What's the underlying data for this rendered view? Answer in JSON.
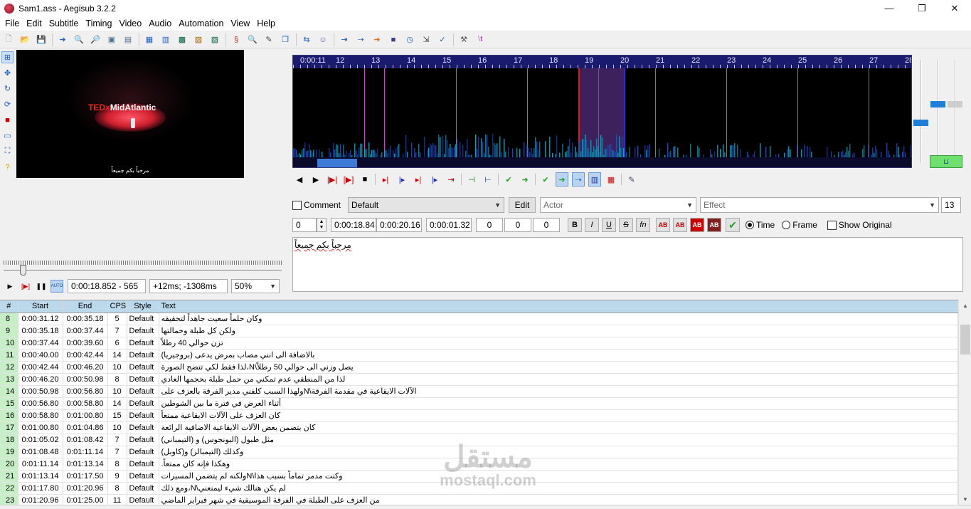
{
  "window": {
    "title": "Sam1.ass - Aegisub 3.2.2",
    "minimize_glyph": "—",
    "maximize_glyph": "❐",
    "close_glyph": "✕"
  },
  "menu": [
    "File",
    "Edit",
    "Subtitle",
    "Timing",
    "Video",
    "Audio",
    "Automation",
    "View",
    "Help"
  ],
  "video": {
    "logo_ted": "TEDx",
    "logo_name": "MidAtlantic",
    "subtitle": "مرحباً بكم جميعاً"
  },
  "video_controls": {
    "time_frame": "0:00:18.852 - 565",
    "offset": "+12ms; -1308ms",
    "zoom": "50%"
  },
  "audio": {
    "ruler_labels": [
      "0:00:11",
      "12",
      "13",
      "14",
      "15",
      "16",
      "17",
      "18",
      "19",
      "20",
      "21",
      "22",
      "23",
      "24",
      "25",
      "26",
      "27",
      "28"
    ]
  },
  "editor": {
    "comment_label": "Comment",
    "style": "Default",
    "edit_button": "Edit",
    "actor_placeholder": "Actor",
    "effect_placeholder": "Effect",
    "line_number": "13",
    "layer": "0",
    "start_time": "0:00:18.84",
    "end_time": "0:00:20.16",
    "duration": "0:00:01.32",
    "margin_left": "0",
    "margin_right": "0",
    "margin_vert": "0",
    "bold": "B",
    "italic": "I",
    "underline": "U",
    "strike": "S",
    "fn": "fn",
    "color_labels": [
      "AB",
      "AB",
      "AB",
      "AB"
    ],
    "time_radio": "Time",
    "frame_radio": "Frame",
    "show_original": "Show Original",
    "text": "مرحباً بكم جميعاً"
  },
  "grid": {
    "headers": [
      "#",
      "Start",
      "End",
      "CPS",
      "Style",
      "Text"
    ],
    "rows": [
      {
        "n": "8",
        "start": "0:00:31.12",
        "end": "0:00:35.18",
        "cps": "5",
        "style": "Default",
        "text": "وكان حلماً سعيت جاهداً لتحقيقه"
      },
      {
        "n": "9",
        "start": "0:00:35.18",
        "end": "0:00:37.44",
        "cps": "7",
        "style": "Default",
        "text": "ولكن كل طبلة وحمالتها"
      },
      {
        "n": "10",
        "start": "0:00:37.44",
        "end": "0:00:39.60",
        "cps": "6",
        "style": "Default",
        "text": "تزن حوالي 40 رطلاً"
      },
      {
        "n": "11",
        "start": "0:00:40.00",
        "end": "0:00:42.44",
        "cps": "14",
        "style": "Default",
        "text": "بالاضافة الى انني مصاب بمرض يدعى (بروجيريا)"
      },
      {
        "n": "12",
        "start": "0:00:42.44",
        "end": "0:00:46.20",
        "cps": "10",
        "style": "Default",
        "text": "يصل وزني الى حوالي 50 رطلاً\\N،لذا فقط لكي تتضح الصورة"
      },
      {
        "n": "13",
        "start": "0:00:46.20",
        "end": "0:00:50.98",
        "cps": "8",
        "style": "Default",
        "text": "لذا من المنطقي عدم تمكني من حمل طبلة بحجمها العادي"
      },
      {
        "n": "14",
        "start": "0:00:50.98",
        "end": "0:00:56.80",
        "cps": "10",
        "style": "Default",
        "text": "الآلات الايقاعية في مقدمة الفرقة\\Nولهذا السبب كلفني مدير الفرقة بالعزف على"
      },
      {
        "n": "15",
        "start": "0:00:56.80",
        "end": "0:00:58.80",
        "cps": "14",
        "style": "Default",
        "text": "أثناء العرض في فترة ما بين الشوطين"
      },
      {
        "n": "16",
        "start": "0:00:58.80",
        "end": "0:01:00.80",
        "cps": "15",
        "style": "Default",
        "text": "كان العزف على الآلات الايقاعية ممتعاً"
      },
      {
        "n": "17",
        "start": "0:01:00.80",
        "end": "0:01:04.86",
        "cps": "10",
        "style": "Default",
        "text": "كان يتضمن بعض الآلات الايقاعية الاضافية الرائعة"
      },
      {
        "n": "18",
        "start": "0:01:05.02",
        "end": "0:01:08.42",
        "cps": "7",
        "style": "Default",
        "text": "مثل طبول (البونجوس) و (التيمباني)"
      },
      {
        "n": "19",
        "start": "0:01:08.48",
        "end": "0:01:11.14",
        "cps": "7",
        "style": "Default",
        "text": "وكذلك (التيمبالز) و(كاوبل)"
      },
      {
        "n": "20",
        "start": "0:01:11.14",
        "end": "0:01:13.14",
        "cps": "8",
        "style": "Default",
        "text": "وهكذا فإنه كان ممتعاً."
      },
      {
        "n": "21",
        "start": "0:01:13.14",
        "end": "0:01:17.50",
        "cps": "9",
        "style": "Default",
        "text": "وكنت مدمر تماماً بسبب هذا\\Nولكنه لم يتضمن المسيرات"
      },
      {
        "n": "22",
        "start": "0:01:17.80",
        "end": "0:01:20.96",
        "cps": "8",
        "style": "Default",
        "text": "لم يكن هنالك شيء ليمنعني\\N،ومع ذلك"
      },
      {
        "n": "23",
        "start": "0:01:20.96",
        "end": "0:01:25.00",
        "cps": "11",
        "style": "Default",
        "text": "من العزف على الطبلة في الفرقة الموسيقية في شهر فبراير الماضي"
      }
    ]
  },
  "watermark": {
    "arabic": "مستقل",
    "latin": "mostaql.com"
  },
  "colors": {
    "ruler_bg": "#1a1a6e",
    "keyframe": "#d042d0",
    "selection": "#6e3caa",
    "grid_header": "#bcd9ec",
    "row_number_bg": "#c8eec8"
  }
}
